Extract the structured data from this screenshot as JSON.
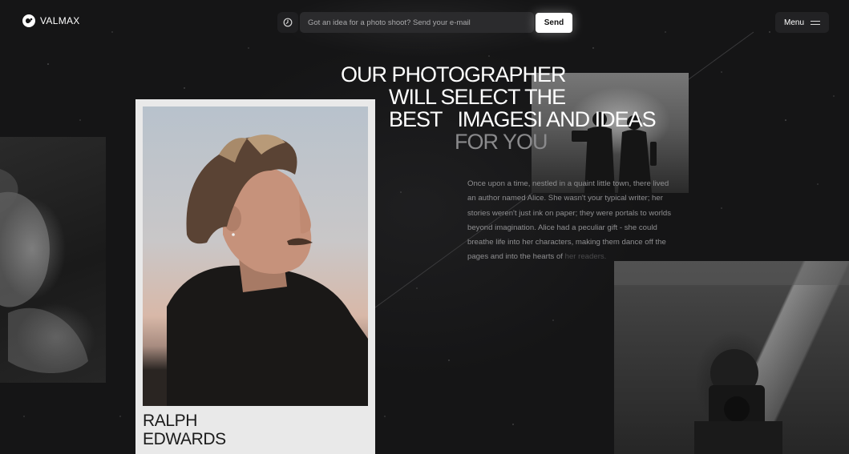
{
  "header": {
    "brand_name": "VALMAX",
    "email_placeholder": "Got an idea for a photo shoot? Send your e-mail",
    "send_label": "Send",
    "menu_label": "Menu"
  },
  "hero": {
    "headline_lines": [
      "OUR PHOTOGRAPHER",
      "WILL SELECT THE",
      "BEST   IMAGESI AND IDEAS",
      "FOR YOU"
    ],
    "story_text": "Once upon a time, nestled in a quaint little town, there lived an author named Alice. She wasn't your typical writer; her stories weren't just ink on paper; they were portals to worlds beyond imagination. Alice had a peculiar gift - she could breathe life into her characters, making them dance off the pages and into the hearts of",
    "story_fade": "her readers."
  },
  "portrait": {
    "first_name": "RALPH",
    "last_name": "EDWARDS"
  },
  "icons": {
    "brand": "valmax-logo-icon",
    "clock": "clock-icon",
    "menu": "hamburger-menu-icon"
  },
  "colors": {
    "background": "#151516",
    "card": "#e9e9e9",
    "accent": "#ffffff",
    "muted_text": "#8a8a8c"
  }
}
